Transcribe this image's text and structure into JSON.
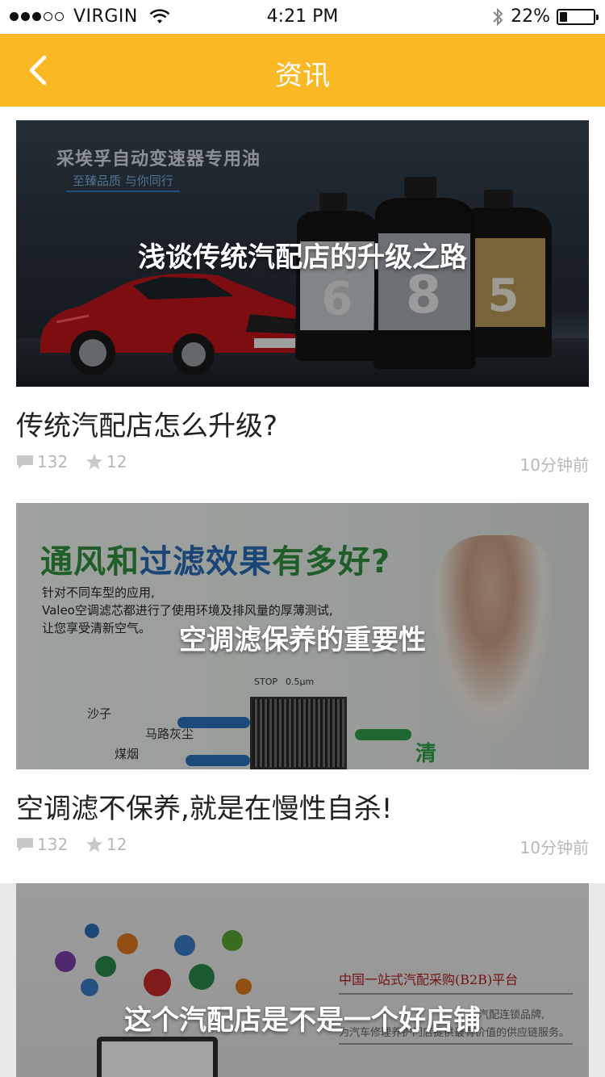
{
  "status_bar": {
    "carrier": "VIRGIN",
    "time": "4:21 PM",
    "battery": "22%",
    "battery_level": 0.22
  },
  "nav": {
    "title": "资讯",
    "back_icon": "chevron-left-icon"
  },
  "articles": [
    {
      "banner_title": "浅谈传统汽配店的升级之路",
      "banner_text_1": "采埃孚自动变速器专用油",
      "banner_text_2": "至臻品质 与你同行",
      "bottle_labels": [
        "6",
        "8",
        "5"
      ],
      "headline": "传统汽配店怎么升级?",
      "comments": "132",
      "stars": "12",
      "time": "10分钟前"
    },
    {
      "banner_title": "空调滤保养的重要性",
      "banner_big_part1": "通风和",
      "banner_big_part2": "过滤效果",
      "banner_big_part3": "有多好?",
      "banner_small_1": "针对不同车型的应用,",
      "banner_small_2": "Valeo空调滤芯都进行了使用环境及排风量的厚薄测试,",
      "banner_small_3": "让您享受清新空气。",
      "label_1": "沙子",
      "label_2": "马路灰尘",
      "label_3": "煤烟",
      "stop_label": "STOP",
      "size_label": "0.5μm",
      "side_label": "清",
      "headline": "空调滤不保养,就是在慢性自杀!",
      "comments": "132",
      "stars": "12",
      "time": "10分钟前"
    },
    {
      "banner_title": "这个汽配店是不是一个好店铺",
      "banner_red": "中国一站式汽配采购(B2B)平台",
      "banner_grey_1": "、汽配连锁品牌,",
      "banner_grey_2": "为汽车修理养护门店提供最有价值的供应链服务。"
    }
  ],
  "colors": {
    "brand": "#f9b824",
    "meta": "#b8b8b8"
  }
}
